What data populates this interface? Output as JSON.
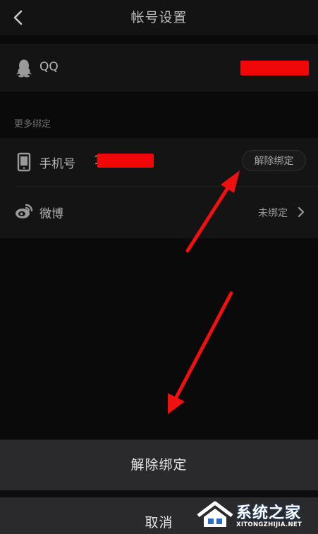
{
  "header": {
    "title": "帐号设置",
    "back_icon": "chevron-left-icon"
  },
  "qq_row": {
    "label": "QQ",
    "icon": "qq-penguin-icon"
  },
  "section": {
    "title": "更多绑定"
  },
  "phone_row": {
    "label": "手机号",
    "number_prefix": "1",
    "icon": "phone-icon",
    "unbind_label": "解除绑定"
  },
  "weibo_row": {
    "label": "微博",
    "status": "未绑定",
    "icon": "weibo-icon"
  },
  "action_sheet": {
    "confirm_label": "解除绑定",
    "cancel_label": "取消"
  },
  "watermark": {
    "title": "系统之家",
    "url": "XITONGZHIJIA.NET"
  },
  "colors": {
    "background": "#0a0a0a",
    "row_background": "#141414",
    "sheet_background": "#2a2a2c",
    "annotation_red": "#f01010",
    "redaction_red": "#f00808"
  }
}
